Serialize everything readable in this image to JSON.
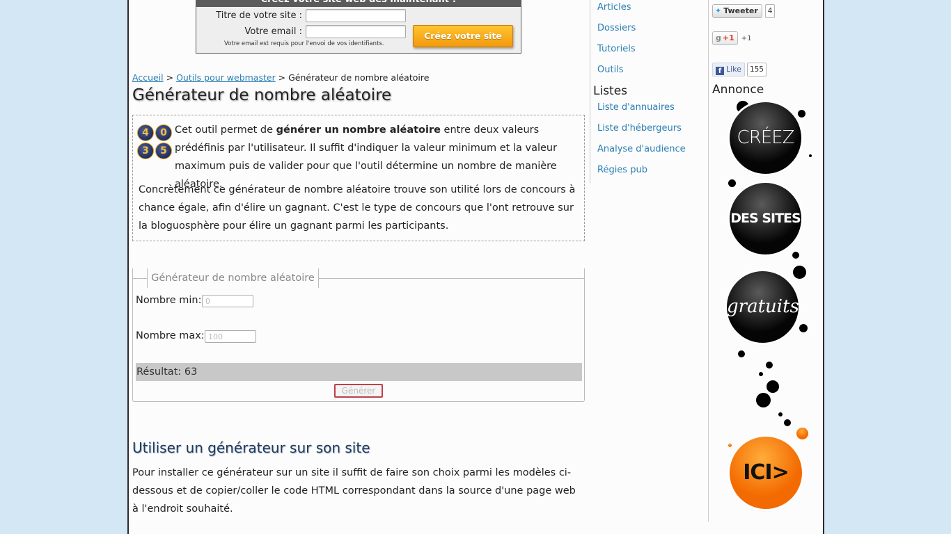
{
  "signup": {
    "heading": "Créez votre site web dès maintenant !",
    "title_label": "Titre de votre site :",
    "email_label": "Votre email :",
    "note": "Votre email est requis pour l'envoi de vos identifiants.",
    "cta": "Créez votre site"
  },
  "breadcrumb": {
    "home": "Accueil",
    "sep1": " > ",
    "section": "Outils pour webmaster",
    "sep2": " > ",
    "current": "Générateur de nombre aléatoire"
  },
  "page_title": "Générateur de nombre aléatoire",
  "intro": {
    "dice": [
      "4",
      "0",
      "3",
      "5"
    ],
    "p1_before": "Cet outil permet de ",
    "p1_bold": "générer un nombre aléatoire",
    "p1_after": " entre deux valeurs prédéfinis par l'utilisateur. Il suffit d'indiquer la valeur minimum et la valeur maximum puis de valider pour que l'outil détermine un nombre de manière aléatoire.",
    "p2": "Concrètement ce générateur de nombre aléatoire trouve son utilité lors de concours à chance égale, afin d'élire un gagnant. C'est le type de concours que l'ont retrouve sur la bloguosphère pour élire un gagnant parmi les participants."
  },
  "generator": {
    "legend": "Générateur de nombre aléatoire",
    "min_label": "Nombre min:",
    "min_placeholder": "0",
    "max_label": "Nombre max:",
    "max_placeholder": "100",
    "result": "Résultat: 63",
    "button": "Générer"
  },
  "usage": {
    "heading": "Utiliser un générateur sur son site",
    "text": "Pour installer ce générateur sur un site il suffit de faire son choix parmi les modèles ci-dessous et de copier/coller le code HTML correspondant dans la source d'une page web à l'endroit souhaité."
  },
  "menu": {
    "items_top": [
      "Articles",
      "Dossiers",
      "Tutoriels",
      "Outils"
    ],
    "lists_heading": "Listes",
    "items_lists": [
      "Liste d'annuaires",
      "Liste d'hébergeurs",
      "Analyse d'audience",
      "Régies pub"
    ]
  },
  "social": {
    "tweet_label": "Tweeter",
    "tweet_count": "4",
    "gplus_label": "+1",
    "gplus_count": "+1",
    "fb_label": "Like",
    "fb_icon": "f",
    "fb_count": "155"
  },
  "ad": {
    "heading": "Annonce",
    "word1": "CRÉEZ",
    "word2": "DES SITES",
    "word3": "gratuits",
    "word4": "ICI>"
  }
}
